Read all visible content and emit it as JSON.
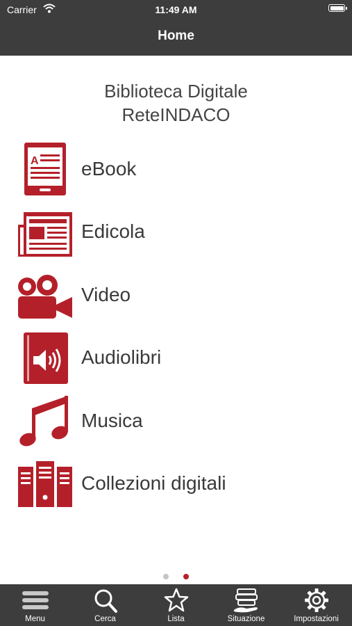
{
  "status_bar": {
    "carrier": "Carrier",
    "time": "11:49 AM"
  },
  "nav": {
    "title": "Home"
  },
  "library": {
    "title_line1": "Biblioteca Digitale",
    "title_line2": "ReteINDACO"
  },
  "menu": {
    "accent_color": "#b4202a",
    "items": [
      {
        "label": "eBook",
        "icon": "ebook-reader-icon"
      },
      {
        "label": "Edicola",
        "icon": "newspaper-icon"
      },
      {
        "label": "Video",
        "icon": "video-camera-icon"
      },
      {
        "label": "Audiolibri",
        "icon": "audiobook-icon"
      },
      {
        "label": "Musica",
        "icon": "music-note-icon"
      },
      {
        "label": "Collezioni digitali",
        "icon": "archive-binders-icon"
      }
    ]
  },
  "pager": {
    "pages": 2,
    "current": 2
  },
  "tabbar": {
    "tabs": [
      {
        "label": "Menu",
        "icon": "hamburger-menu-icon"
      },
      {
        "label": "Cerca",
        "icon": "search-icon"
      },
      {
        "label": "Lista",
        "icon": "star-icon"
      },
      {
        "label": "Situazione",
        "icon": "books-hand-icon"
      },
      {
        "label": "Impostazioni",
        "icon": "gear-icon"
      }
    ]
  }
}
